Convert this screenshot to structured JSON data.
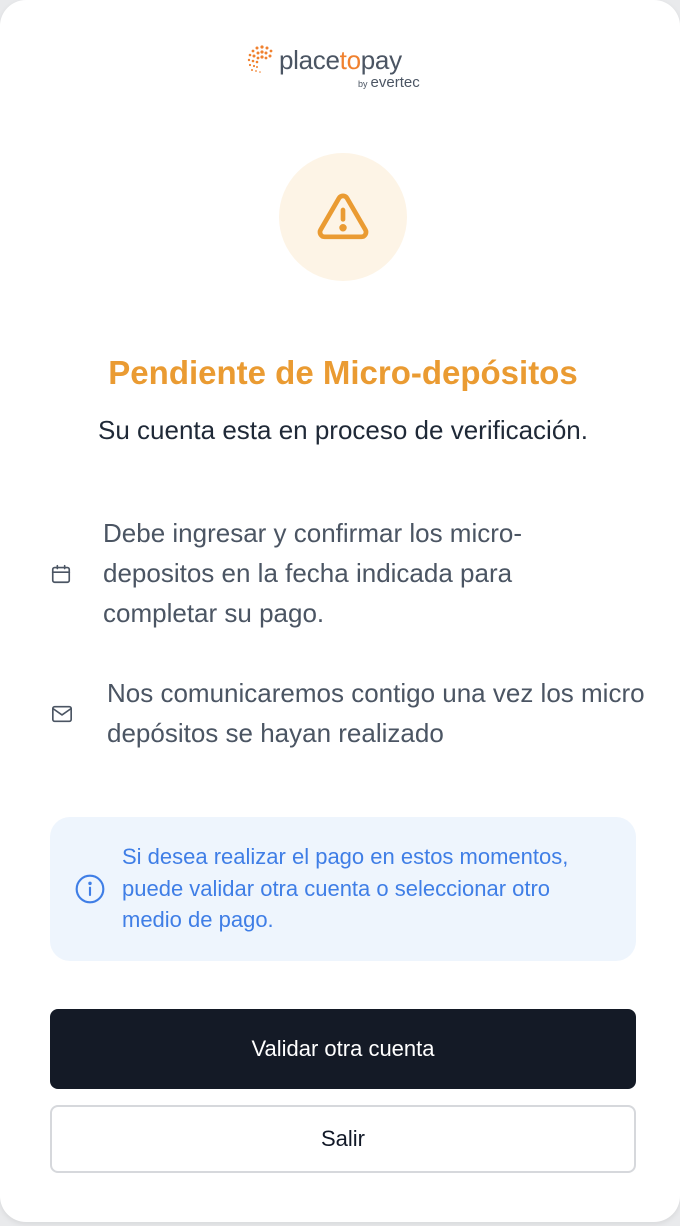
{
  "brand": {
    "logo_text_part1": "place",
    "logo_text_part2": "to",
    "logo_text_part3": "pay",
    "logo_by": "by",
    "logo_sub": "evertec",
    "accent_color": "#f0812f"
  },
  "status": {
    "icon": "warning-triangle-icon",
    "title": "Pendiente de Micro-depósitos",
    "subtitle": "Su cuenta esta en proceso de verificación.",
    "title_color": "#ea9b32"
  },
  "info_items": [
    {
      "icon": "calendar-icon",
      "text": "Debe ingresar y confirmar los micro-depositos en la fecha indicada para completar su pago."
    },
    {
      "icon": "mail-icon",
      "text": "Nos comunicaremos contigo una vez los micro depósitos se hayan realizado"
    }
  ],
  "notice": {
    "icon": "info-circle-icon",
    "text": "Si desea realizar el pago en estos momentos, puede validar otra cuenta o seleccionar otro medio de pago.",
    "color": "#3f7ee6"
  },
  "actions": {
    "primary_label": "Validar otra cuenta",
    "secondary_label": "Salir"
  }
}
